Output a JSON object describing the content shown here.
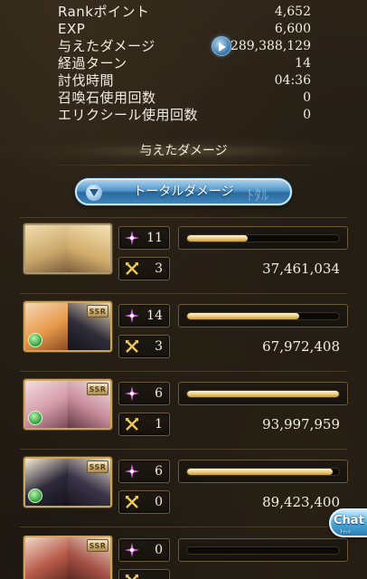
{
  "stats": [
    {
      "label": "Rankポイント",
      "value": "4,652"
    },
    {
      "label": "EXP",
      "value": "6,600"
    },
    {
      "label": "与えたダメージ",
      "value": "289,388,129"
    },
    {
      "label": "経過ターン",
      "value": "14"
    },
    {
      "label": "討伐時間",
      "value": "04:36"
    },
    {
      "label": "召喚石使用回数",
      "value": "0"
    },
    {
      "label": "エリクシール使用回数",
      "value": "0"
    }
  ],
  "section_title": "与えたダメージ",
  "dropdown": {
    "label": "トータルダメージ",
    "deco": "ﾄﾀﾙ"
  },
  "characters": [
    {
      "name": "main-character",
      "rarity": "",
      "skill_uses": "11",
      "ougi_uses": "3",
      "gauge_fraction": 0.4,
      "damage": "37,461,034"
    },
    {
      "name": "character-2",
      "rarity": "SSR",
      "skill_uses": "14",
      "ougi_uses": "3",
      "gauge_fraction": 0.74,
      "damage": "67,972,408"
    },
    {
      "name": "character-3",
      "rarity": "SSR",
      "skill_uses": "6",
      "ougi_uses": "1",
      "gauge_fraction": 1.0,
      "damage": "93,997,959"
    },
    {
      "name": "character-4",
      "rarity": "SSR",
      "skill_uses": "6",
      "ougi_uses": "0",
      "gauge_fraction": 0.96,
      "damage": "89,423,400"
    },
    {
      "name": "character-5",
      "rarity": "SSR",
      "skill_uses": "0",
      "ougi_uses": "",
      "gauge_fraction": 0.0,
      "damage": ""
    }
  ],
  "chat": {
    "label": "Chat",
    "sub": "ﾁｬｯﾄ"
  },
  "colors": {
    "gold": "#c9a65a",
    "skill_icon": "#e06ce6",
    "ougi_icon": "#e9c85a",
    "gauge": "#f2d38a",
    "chat": "#4aa6d8"
  }
}
